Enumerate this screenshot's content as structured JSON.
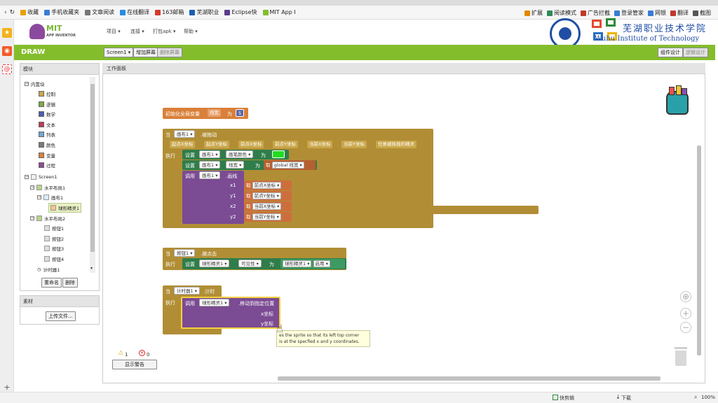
{
  "browser": {
    "bookmarks": [
      {
        "label": "收藏",
        "color": "#e7a100"
      },
      {
        "label": "手机收藏夹",
        "color": "#3a7bd5"
      },
      {
        "label": "文章阅读",
        "color": "#777777"
      },
      {
        "label": "在线翻译",
        "color": "#2b8be0"
      },
      {
        "label": "163邮箱",
        "color": "#d23b2b"
      },
      {
        "label": "芜湖职业",
        "color": "#1a5fb4"
      },
      {
        "label": "Eclipse快",
        "color": "#5a3c8c"
      },
      {
        "label": "MIT App I",
        "color": "#84bd2c"
      }
    ],
    "right_tools": [
      {
        "label": "扩展",
        "color": "#e08a00"
      },
      {
        "label": "阅读模式",
        "color": "#2e8b57"
      },
      {
        "label": "广告拦截",
        "color": "#c0392b"
      },
      {
        "label": "登录管家",
        "color": "#3a7bd5"
      },
      {
        "label": "网银",
        "color": "#3a7bd5"
      },
      {
        "label": "翻译",
        "color": "#c0392b"
      },
      {
        "label": "截图",
        "color": "#555555"
      }
    ]
  },
  "app": {
    "logo_top": "MIT",
    "logo_bottom": "APP INVENTOR",
    "menus": [
      "项目 ▾",
      "连接 ▾",
      "打包apk ▾",
      "帮助 ▾"
    ],
    "watermark_cn": "芜湖职业技术学院",
    "watermark_en": "Wuhu Institute of Technology",
    "project_title": "DRAW",
    "screen_dropdown": "Screen1 ▾",
    "add_screen": "增加屏幕",
    "remove_screen": "删除屏幕",
    "designer_btn": "组件设计",
    "blocks_btn": "逻辑设计"
  },
  "blocks_panel": {
    "header": "模块",
    "builtin": "内置块",
    "builtin_items": [
      {
        "label": "控制",
        "color": "#c9a64a"
      },
      {
        "label": "逻辑",
        "color": "#7ca943"
      },
      {
        "label": "数学",
        "color": "#4a5fb0"
      },
      {
        "label": "文本",
        "color": "#c0395a"
      },
      {
        "label": "列表",
        "color": "#6fa6d6"
      },
      {
        "label": "颜色",
        "color": "#7b7b7b"
      },
      {
        "label": "变量",
        "color": "#d9803a"
      },
      {
        "label": "过程",
        "color": "#8e4b93"
      }
    ],
    "screen": "Screen1",
    "hbox1": "水平布局1",
    "canvas": "画布1",
    "sprite": "球形精灵1",
    "hbox2": "水平布局2",
    "buttons": [
      "按钮1",
      "按钮2",
      "按钮3",
      "按钮4"
    ],
    "timer": "计时器1",
    "rename": "重命名",
    "delete": "删除",
    "assets_header": "素材",
    "upload": "上传文件..."
  },
  "workspace": {
    "header": "工作面板",
    "init_var": {
      "label": "初始化全局变量",
      "name": "线宽",
      "to": "为",
      "value": "5"
    },
    "drag_event": {
      "when": "当",
      "component": "画布1 ▾",
      "event": ".被拖动",
      "params": [
        "起点X坐标",
        "起点Y坐标",
        "前点X坐标",
        "前点Y坐标",
        "当前X坐标",
        "当前Y坐标",
        "任意被拖拽的精灵"
      ],
      "do": "执行",
      "set1": {
        "set": "设置",
        "comp": "画布1 ▾",
        "prop": "画笔颜色 ▾",
        "to": "为",
        "color": "#22dd22"
      },
      "set2": {
        "set": "设置",
        "comp": "画布1 ▾",
        "prop": "线宽 ▾",
        "to": "为",
        "get": "取",
        "var": "global 线宽 ▾"
      },
      "call": {
        "call": "调用",
        "comp": "画布1 ▾",
        "method": ".画线"
      },
      "args": [
        {
          "name": "x1",
          "get": "取",
          "var": "前点X坐标 ▾"
        },
        {
          "name": "y1",
          "get": "取",
          "var": "前点Y坐标 ▾"
        },
        {
          "name": "x2",
          "get": "取",
          "var": "当前X坐标 ▾"
        },
        {
          "name": "y2",
          "get": "取",
          "var": "当前Y坐标 ▾"
        }
      ]
    },
    "click_event": {
      "when": "当",
      "component": "按钮1 ▾",
      "event": ".被点击",
      "do": "执行",
      "set": "设置",
      "comp": "球形精灵1 ▾",
      "prop": "可见性 ▾",
      "to": "为",
      "value_comp": "球形精灵1 ▾",
      "value_prop": "启用 ▾"
    },
    "timer_event": {
      "when": "当",
      "component": "计时器1 ▾",
      "event": ".计时",
      "do": "执行",
      "call": "调用",
      "comp": "球形精灵1 ▾",
      "method": ".移动到指定位置",
      "arg_x": "x坐标",
      "arg_y": "y坐标"
    },
    "tooltip_line1": "es the sprite so that its left top corner",
    "tooltip_line2": "is at the specfied x and y coordinates.",
    "warnings": "1",
    "errors": "0",
    "show_warnings": "显示警告"
  },
  "status": {
    "quick_edit": "快剪辑",
    "download": "下载",
    "zoom": "100%"
  }
}
